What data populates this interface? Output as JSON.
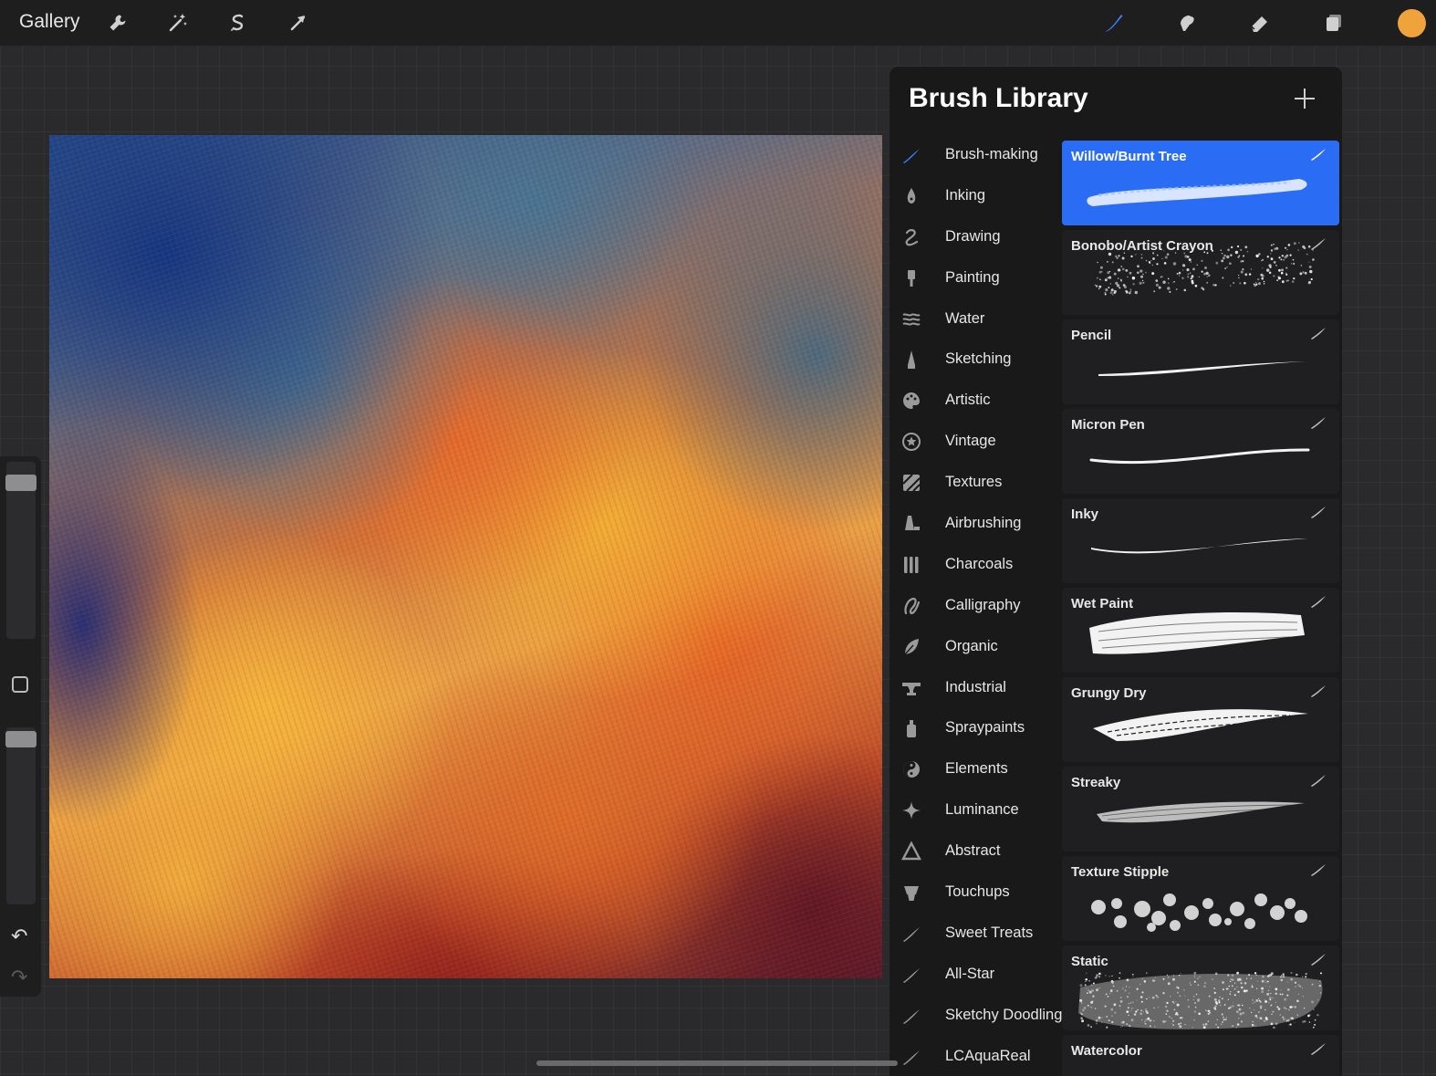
{
  "topbar": {
    "gallery_label": "Gallery",
    "left_tools": [
      "wrench-icon",
      "magic-wand-icon",
      "selection-icon",
      "transform-arrow-icon"
    ],
    "right_tools": [
      "brush-icon",
      "smudge-icon",
      "eraser-icon",
      "layers-icon"
    ],
    "active_tool": "brush-icon",
    "current_color": "#f0a23b"
  },
  "brush_library": {
    "title": "Brush Library",
    "add_icon": "plus-icon",
    "selected_set": "Brush-making",
    "sets": [
      {
        "label": "Brush-making",
        "icon": "brush-stroke-icon"
      },
      {
        "label": "Inking",
        "icon": "ink-drop-icon"
      },
      {
        "label": "Drawing",
        "icon": "drawing-squiggle-icon"
      },
      {
        "label": "Painting",
        "icon": "paint-brush-icon"
      },
      {
        "label": "Water",
        "icon": "water-waves-icon"
      },
      {
        "label": "Sketching",
        "icon": "pencil-tip-icon"
      },
      {
        "label": "Artistic",
        "icon": "palette-icon"
      },
      {
        "label": "Vintage",
        "icon": "star-badge-icon"
      },
      {
        "label": "Textures",
        "icon": "texture-hatch-icon"
      },
      {
        "label": "Airbrushing",
        "icon": "airbrush-icon"
      },
      {
        "label": "Charcoals",
        "icon": "charcoal-sticks-icon"
      },
      {
        "label": "Calligraphy",
        "icon": "calligraphy-icon"
      },
      {
        "label": "Organic",
        "icon": "leaf-icon"
      },
      {
        "label": "Industrial",
        "icon": "anvil-icon"
      },
      {
        "label": "Spraypaints",
        "icon": "spray-can-icon"
      },
      {
        "label": "Elements",
        "icon": "yin-yang-icon"
      },
      {
        "label": "Luminance",
        "icon": "sparkle-icon"
      },
      {
        "label": "Abstract",
        "icon": "triangle-icon"
      },
      {
        "label": "Touchups",
        "icon": "touchup-icon"
      },
      {
        "label": "Sweet Treats",
        "icon": "brush-stroke-icon"
      },
      {
        "label": "All-Star",
        "icon": "brush-stroke-icon"
      },
      {
        "label": "Sketchy Doodling",
        "icon": "brush-stroke-icon"
      },
      {
        "label": "LCAquaReal",
        "icon": "brush-stroke-icon"
      }
    ],
    "brushes": [
      {
        "name": "Willow/Burnt Tree",
        "stroke": "textured",
        "selected": true
      },
      {
        "name": "Bonobo/Artist Crayon",
        "stroke": "grainy",
        "selected": false
      },
      {
        "name": "Pencil",
        "stroke": "thin",
        "selected": false
      },
      {
        "name": "Micron Pen",
        "stroke": "line",
        "selected": false
      },
      {
        "name": "Inky",
        "stroke": "taper",
        "selected": false
      },
      {
        "name": "Wet Paint",
        "stroke": "wide",
        "selected": false
      },
      {
        "name": "Grungy Dry",
        "stroke": "dry",
        "selected": false
      },
      {
        "name": "Streaky",
        "stroke": "streaky",
        "selected": false
      },
      {
        "name": "Texture Stipple",
        "stroke": "stipple",
        "selected": false
      },
      {
        "name": "Static",
        "stroke": "static",
        "selected": false
      },
      {
        "name": "Watercolor",
        "stroke": "thin",
        "selected": false
      }
    ]
  },
  "sidebar": {
    "brush_size": 0.92,
    "opacity": 0.98,
    "undo_icon": "undo-icon",
    "redo_icon": "redo-icon"
  }
}
